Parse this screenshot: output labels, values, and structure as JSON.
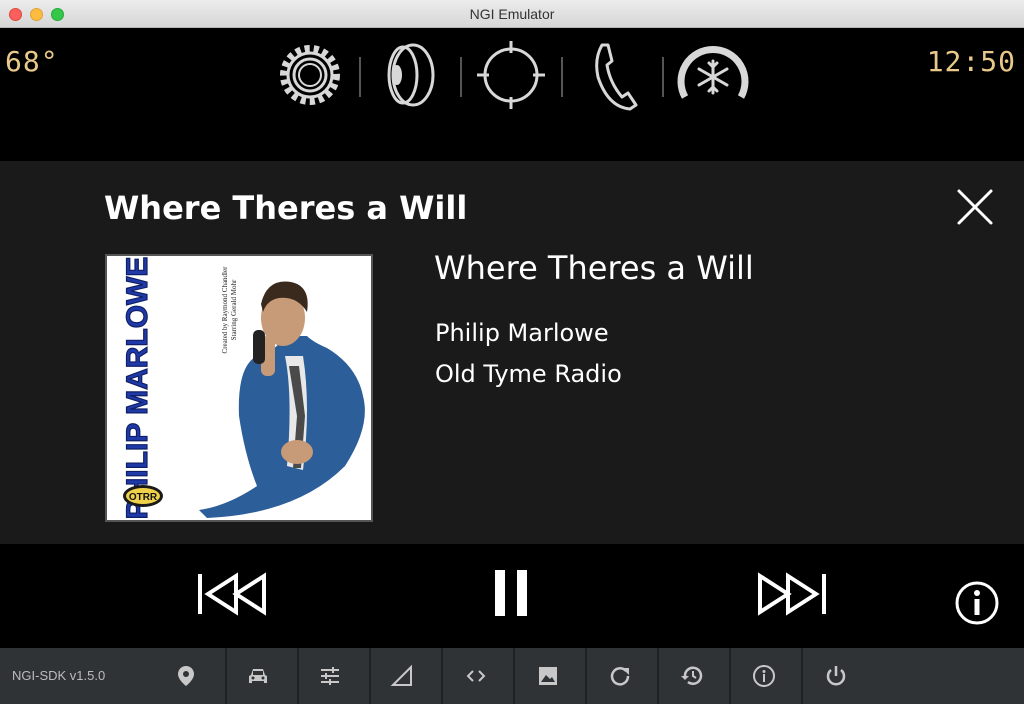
{
  "window": {
    "title": "NGI Emulator"
  },
  "status": {
    "temperature": "68°",
    "time": "12:50"
  },
  "status_icons": [
    "settings-gear-icon",
    "audio-speaker-icon",
    "navigation-crosshair-icon",
    "phone-icon",
    "climate-fan-icon"
  ],
  "now_playing": {
    "header": "Where Theres a Will",
    "title": "Where Theres a Will",
    "artist": "Philip Marlowe",
    "album": "Old Tyme Radio",
    "art": {
      "name_text": "PHILIP MARLOWE",
      "credit_line_1": "Created by Raymond Chandler",
      "credit_line_2": "Starring Gerald Mohr",
      "badge": "OTRR"
    }
  },
  "transport": [
    "previous-track",
    "pause",
    "next-track",
    "info"
  ],
  "sdk": {
    "version": "NGI-SDK v1.5.0",
    "tools": [
      "location-pin-icon",
      "car-icon",
      "sliders-icon",
      "signal-icon",
      "code-icon",
      "image-icon",
      "refresh-icon",
      "history-icon",
      "info-icon",
      "power-icon"
    ]
  },
  "colors": {
    "accent_amber": "#e9c98a",
    "panel": "#1a1a1a",
    "sdk_bar": "#303336"
  }
}
